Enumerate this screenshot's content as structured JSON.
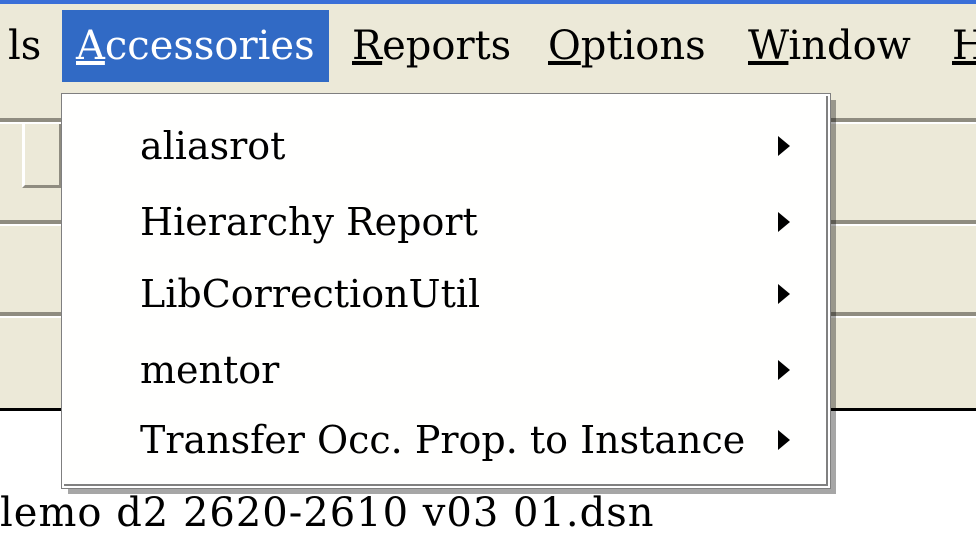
{
  "menubar": {
    "items": [
      {
        "label": "ls",
        "u": ""
      },
      {
        "label": "ccessories",
        "u": "A"
      },
      {
        "label": "eports",
        "u": "R"
      },
      {
        "label": "ptions",
        "u": "O"
      },
      {
        "label": "indow",
        "u": "W"
      },
      {
        "label": "",
        "u": "H"
      }
    ]
  },
  "dropdown": {
    "items": [
      {
        "label": "aliasrot"
      },
      {
        "label": "Hierarchy Report"
      },
      {
        "label": "LibCorrectionUtil"
      },
      {
        "label": "mentor"
      },
      {
        "label": "Transfer Occ. Prop. to Instance"
      }
    ],
    "submenu_arrow_icon": "triangle-right"
  },
  "status": {
    "filename": "lemo  d2  2620-2610  v03  01.dsn"
  },
  "colors": {
    "menubar_bg": "#ece9d8",
    "highlight": "#316ac5",
    "top_border": "#3a6fd8"
  }
}
